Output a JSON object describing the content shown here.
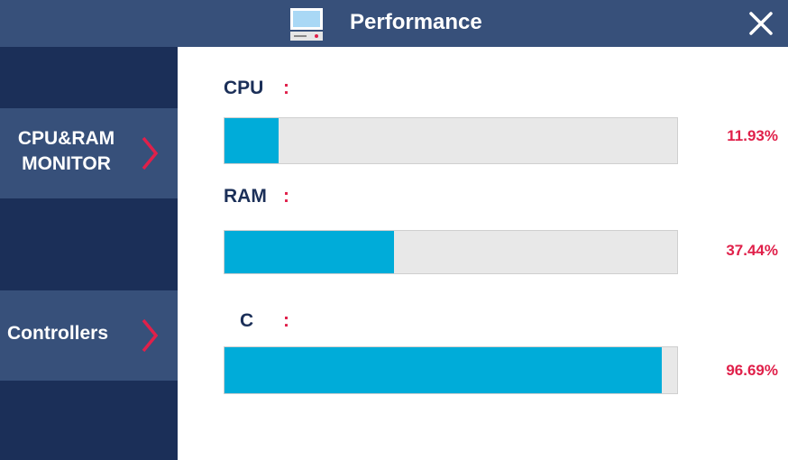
{
  "window": {
    "title": "Performance",
    "icons": {
      "app": "computer-icon",
      "close": "close-icon"
    }
  },
  "sidebar": {
    "items": [
      {
        "label_line1": "CPU&RAM",
        "label_line2": "MONITOR",
        "icon": "chevron-right-icon"
      },
      {
        "label": "Controllers",
        "icon": "chevron-right-icon"
      }
    ]
  },
  "metrics": [
    {
      "label": "CPU",
      "colon": ":",
      "percent_text": "11.93%",
      "percent": 11.93
    },
    {
      "label": "RAM",
      "colon": ":",
      "percent_text": "37.44%",
      "percent": 37.44
    },
    {
      "label": "C",
      "colon": ":",
      "percent_text": "96.69%",
      "percent": 96.69
    }
  ],
  "colors": {
    "titlebar": "#37507a",
    "sidebar": "#1b2f58",
    "nav_item": "#37507a",
    "accent": "#e0204a",
    "bar_fill": "#00acd9",
    "bar_track": "#e8e8e8"
  }
}
